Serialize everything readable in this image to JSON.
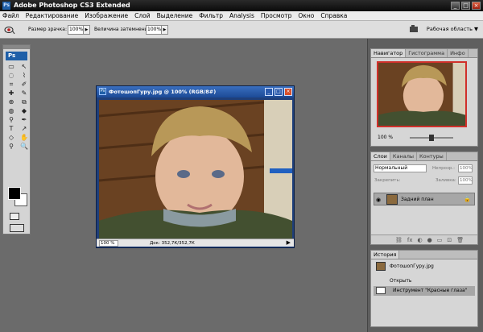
{
  "window": {
    "title": "Adobe Photoshop CS3 Extended",
    "controls": {
      "min": "_",
      "max": "□",
      "close": "×"
    }
  },
  "menu": [
    "Файл",
    "Редактирование",
    "Изображение",
    "Слой",
    "Выделение",
    "Фильтр",
    "Analysis",
    "Просмотр",
    "Окно",
    "Справка"
  ],
  "options": {
    "pupil_label": "Размер зрачка:",
    "pupil_value": "100%",
    "darken_label": "Величина затемнения:",
    "darken_value": "100%",
    "stepper_arrow": "▶",
    "workspace": "Рабочая область ▼"
  },
  "toolbox": {
    "logo": "Ps",
    "tools": [
      "▭",
      "↖",
      "◌",
      "⌇",
      "⌗",
      "✐",
      "✚",
      "✎",
      "⊕",
      "⧉",
      "◍",
      "◆",
      "⚲",
      "✒",
      "T",
      "↗",
      "◇",
      "✋",
      "⚲",
      "🔍"
    ]
  },
  "document": {
    "title": "ФотошопГуру.jpg @ 100% (RGB/8#)",
    "ps_icon": "Ps",
    "zoom": "100 %",
    "doc_info": "Док: 352,7К/352,7К",
    "status_arrow": "▶",
    "controls": {
      "min": "_",
      "max": "□",
      "close": "×"
    }
  },
  "navigator": {
    "tabs": [
      "Навигатор",
      "Гистограмма",
      "Инфо"
    ],
    "zoom": "100 %"
  },
  "layers": {
    "tabs": [
      "Слои",
      "Каналы",
      "Контуры"
    ],
    "blend_mode": "Нормальный",
    "opacity_label": "Непрозр.:",
    "opacity_value": "100%",
    "lock_label": "Закрепить:",
    "fill_label": "Заливка:",
    "fill_value": "100%",
    "layer_name": "Задний план",
    "footer_icons": [
      "⛓",
      "fx",
      "◐",
      "●",
      "▭",
      "⊡",
      "🗑"
    ]
  },
  "history": {
    "tab": "История",
    "items": [
      {
        "text": "ФотошопГуру.jpg"
      },
      {
        "text": "Открыть"
      },
      {
        "text": "Инструмент \"Красные глаза\""
      }
    ]
  },
  "colors": {
    "bg": "#6b6b6b",
    "panel": "#d6d6d6",
    "title_blue": "#1c4a96",
    "accent_red": "#d0302a"
  }
}
